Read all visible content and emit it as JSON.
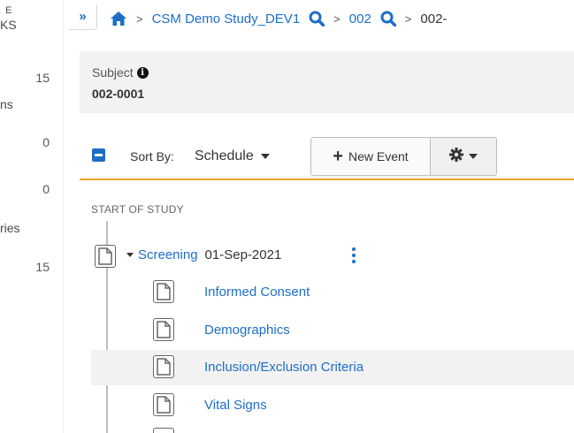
{
  "left_panel": {
    "items": [
      {
        "label_fragment": "E",
        "sub": "KS"
      },
      {
        "count": "15"
      },
      {
        "label_fragment": "ns"
      },
      {
        "count": "0"
      },
      {
        "count": "0"
      },
      {
        "label_fragment": "ries"
      },
      {
        "count": "15"
      }
    ]
  },
  "breadcrumb": {
    "collapse_label": "»",
    "study": "CSM Demo Study_DEV1",
    "site": "002",
    "subject_partial": "002-"
  },
  "subject": {
    "label": "Subject",
    "id": "002-0001"
  },
  "toolbar": {
    "sort_label": "Sort By:",
    "sort_value": "Schedule",
    "new_event_label": "New Event"
  },
  "timeline": {
    "start_label": "START OF STUDY",
    "event": {
      "name": "Screening",
      "date": "01-Sep-2021"
    },
    "forms": [
      {
        "label": "Informed Consent",
        "highlighted": false
      },
      {
        "label": "Demographics",
        "highlighted": false
      },
      {
        "label": "Inclusion/Exclusion Criteria",
        "highlighted": true
      },
      {
        "label": "Vital Signs",
        "highlighted": false
      }
    ]
  },
  "colors": {
    "accent": "#1d6ec7",
    "divider": "#f0a22e",
    "highlight_row": "#f2f2f2"
  }
}
